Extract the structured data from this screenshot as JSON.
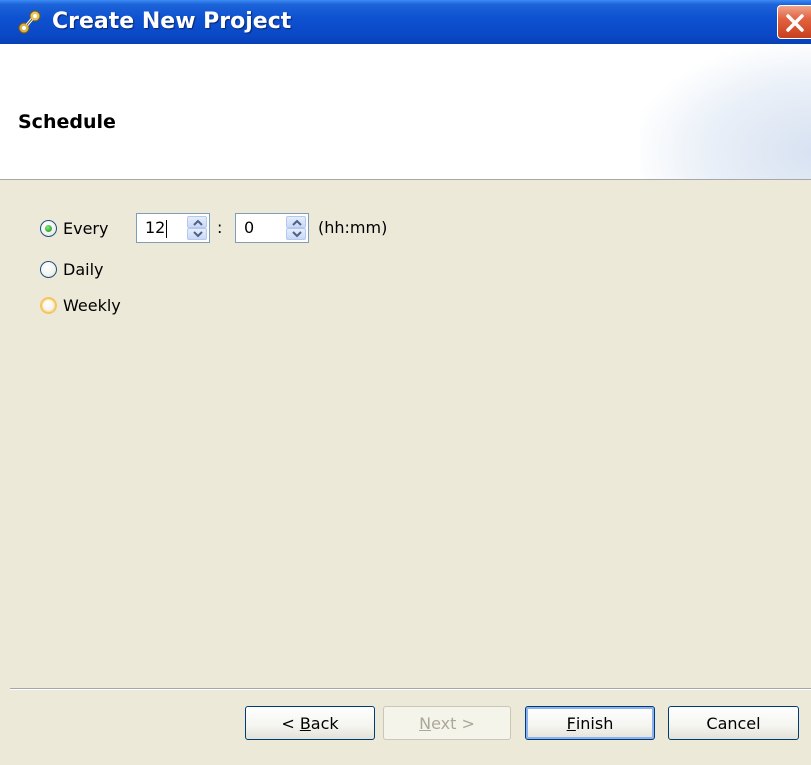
{
  "window": {
    "title": "Create New Project"
  },
  "header": {
    "title": "Schedule"
  },
  "schedule": {
    "every_label": "Every",
    "hours_value": "12",
    "separator": ":",
    "minutes_value": "0",
    "unit_label": "(hh:mm)",
    "daily_label": "Daily",
    "weekly_label": "Weekly",
    "selected": "Every"
  },
  "buttons": {
    "back_key": "B",
    "back_rest": "ack",
    "back_prefix": "< ",
    "next_key": "N",
    "next_rest": "ext >",
    "finish_key": "F",
    "finish_rest": "inish",
    "cancel": "Cancel"
  },
  "icons": {
    "title": "project-wizard-icon",
    "close": "close-icon"
  },
  "colors": {
    "titlebar": "#0A48C6",
    "close": "#E2623F",
    "dialog_bg": "#ECE9D8",
    "radio_selected": "#3BB43A"
  }
}
